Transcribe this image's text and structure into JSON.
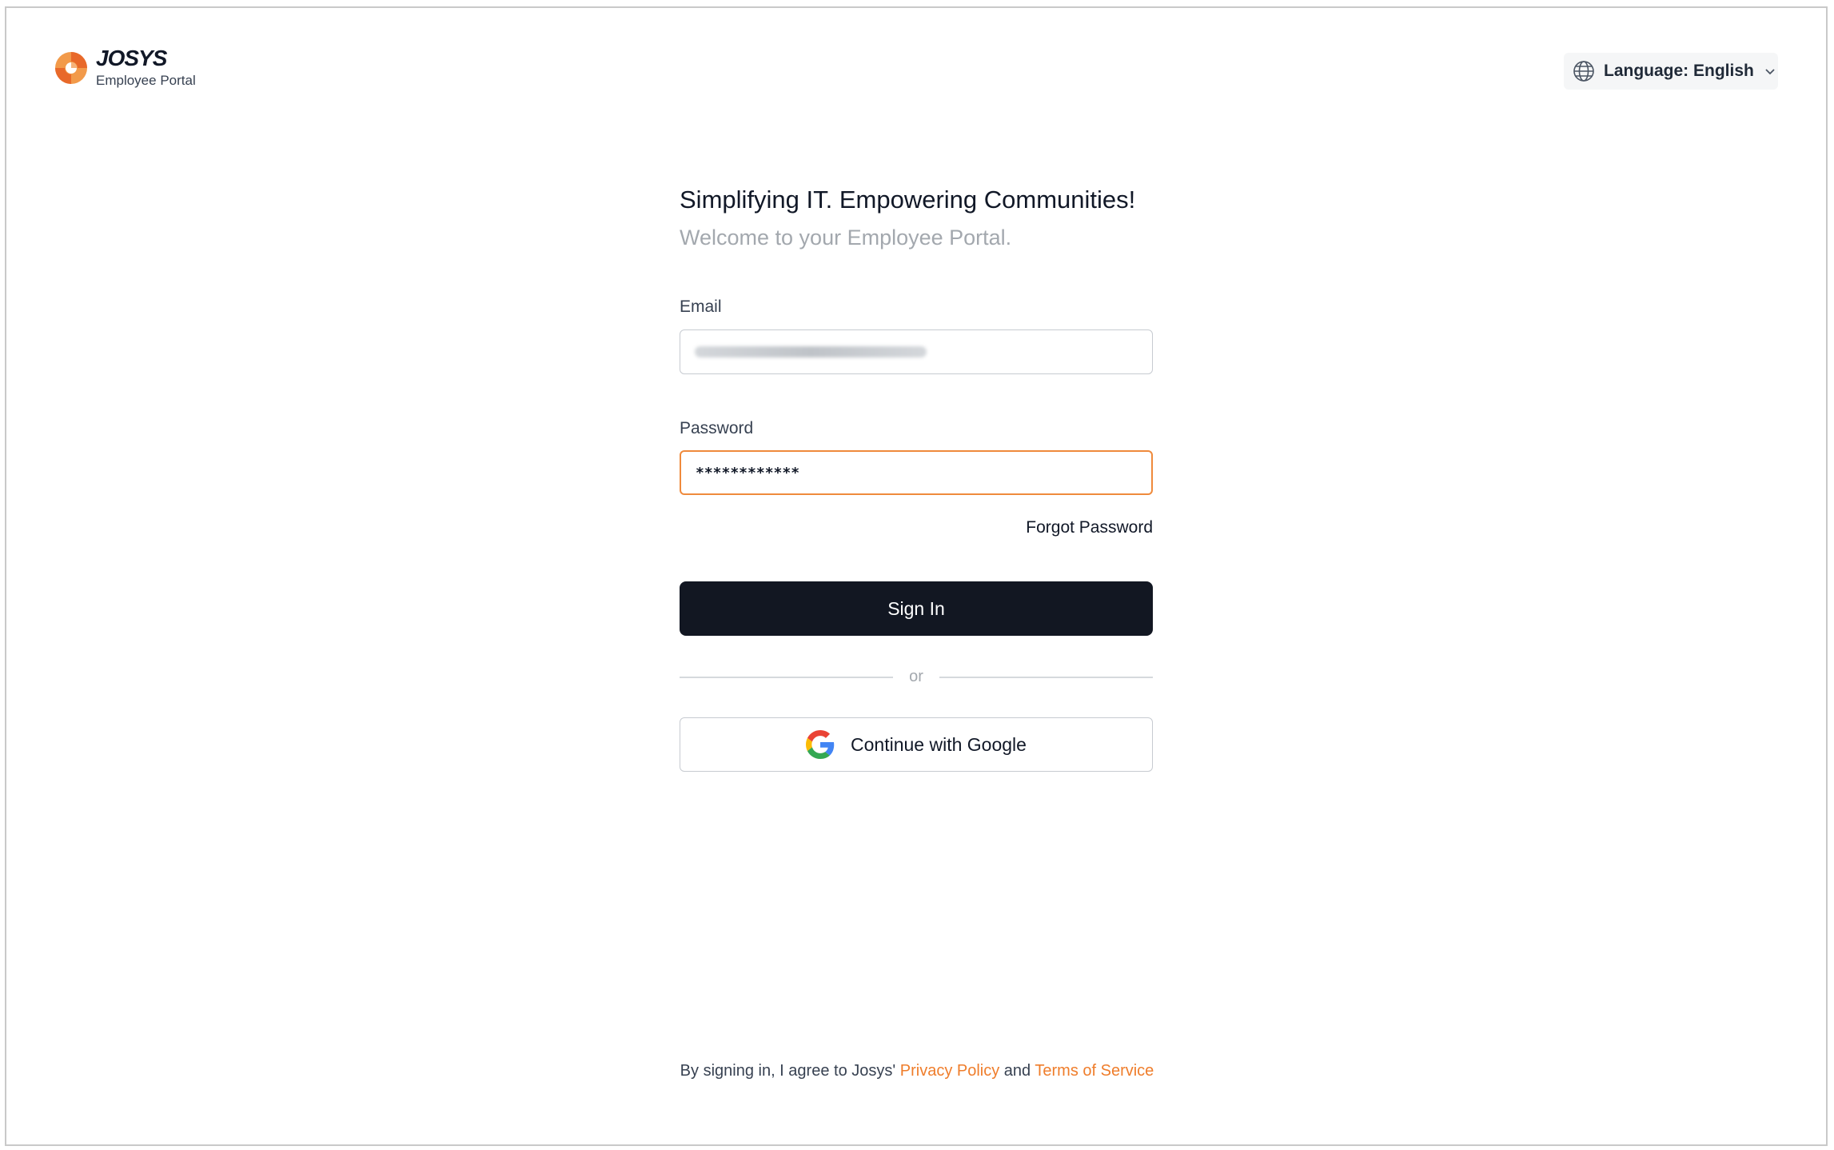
{
  "brand": {
    "name": "JOSYS",
    "subtitle": "Employee Portal",
    "accent_color": "#ef7d2b",
    "logo_icon": "josys-swirl-logo-icon"
  },
  "language": {
    "label": "Language: English",
    "icon": "globe-icon",
    "dropdown_icon": "chevron-down-icon"
  },
  "hero": {
    "heading": "Simplifying IT. Empowering Communities!",
    "subheading": "Welcome to your Employee Portal."
  },
  "form": {
    "email_label": "Email",
    "email_value_redacted": true,
    "password_label": "Password",
    "password_value": "************",
    "forgot_password": "Forgot Password",
    "sign_in": "Sign In",
    "or": "or",
    "google_button": "Continue with Google",
    "google_icon": "google-g-icon"
  },
  "footer": {
    "prefix": "By signing in, I agree to Josys'",
    "privacy": "Privacy Policy",
    "and": "and",
    "terms": "Terms of Service"
  },
  "colors": {
    "primary_button": "#121722",
    "focus_border": "#ef8a3c",
    "link": "#ef7d2b"
  }
}
